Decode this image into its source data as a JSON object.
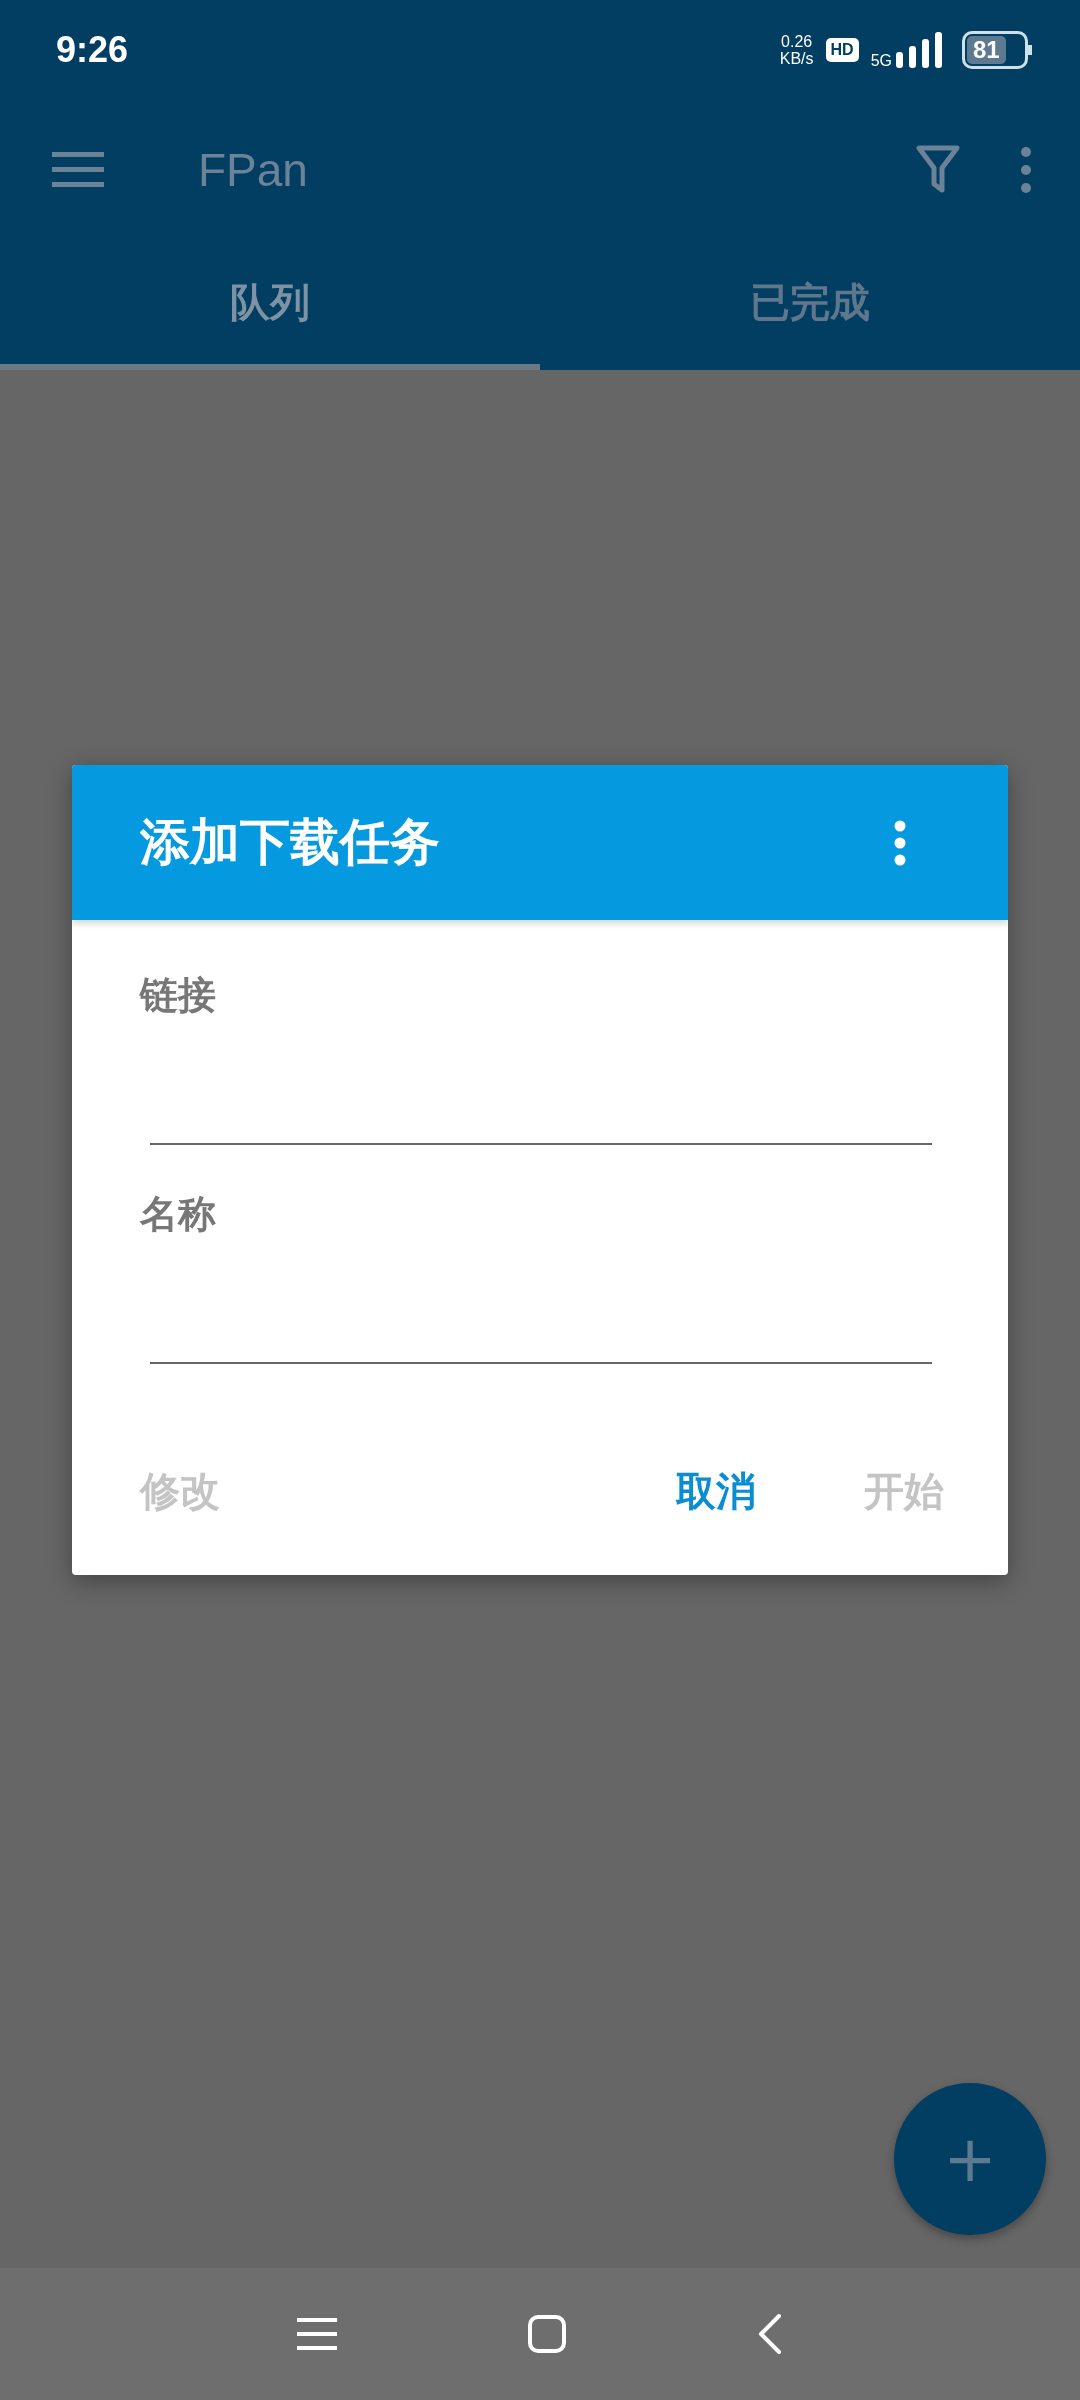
{
  "status_bar": {
    "time": "9:26",
    "net_speed": [
      "0.26",
      "KB/s"
    ],
    "hd_badge": "HD",
    "network": "5G",
    "battery": "81"
  },
  "app_bar": {
    "title": "FPan"
  },
  "tabs": [
    {
      "label": "队列",
      "selected": true
    },
    {
      "label": "已完成",
      "selected": false
    }
  ],
  "dialog": {
    "title": "添加下载任务",
    "fields": [
      {
        "label": "链接"
      },
      {
        "label": "名称"
      }
    ],
    "left_buttons": [
      {
        "label": "修改",
        "disabled": true
      }
    ],
    "right_buttons": [
      {
        "label": "取消",
        "disabled": false
      },
      {
        "label": "开始",
        "disabled": true
      }
    ]
  },
  "fab": {
    "label": "+"
  }
}
